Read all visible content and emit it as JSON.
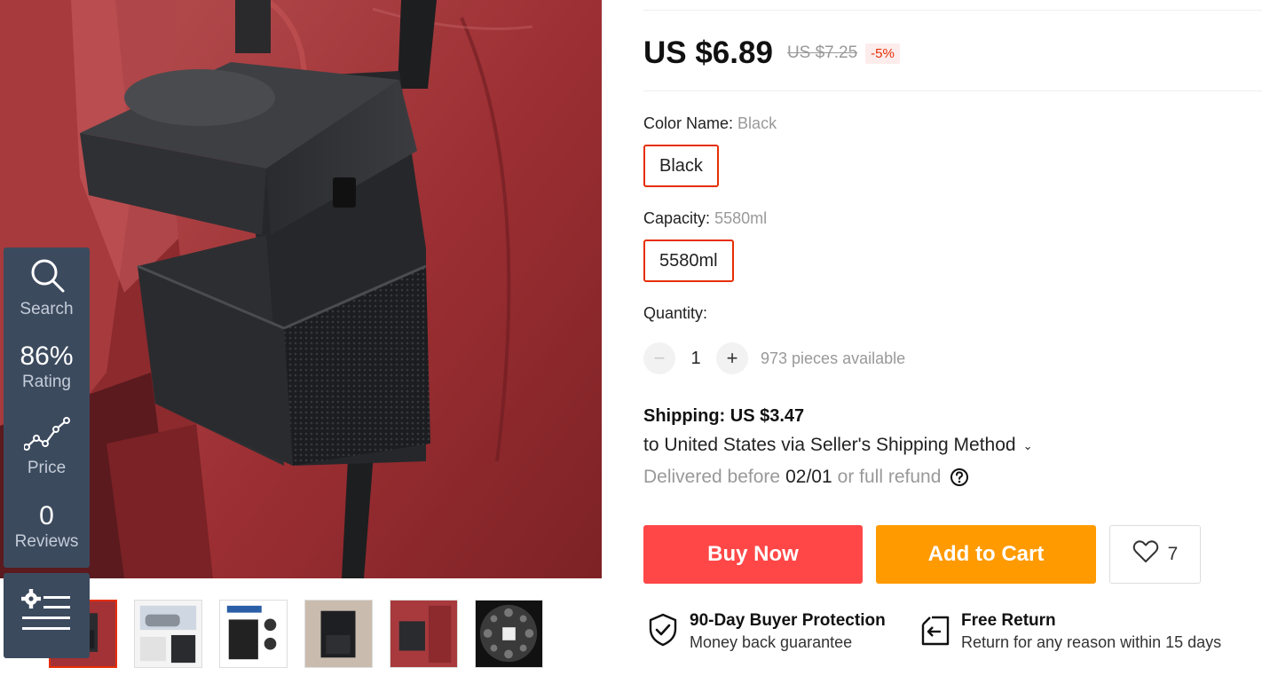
{
  "gallery": {
    "thumbnails": [
      {
        "name": "thumb-1",
        "active": true
      },
      {
        "name": "thumb-2",
        "active": false
      },
      {
        "name": "thumb-3",
        "active": false
      },
      {
        "name": "thumb-4",
        "active": false
      },
      {
        "name": "thumb-5",
        "active": false
      },
      {
        "name": "thumb-6",
        "active": false
      }
    ]
  },
  "side_widget": {
    "search_label": "Search",
    "rating_value": "86%",
    "rating_label": "Rating",
    "price_label": "Price",
    "reviews_value": "0",
    "reviews_label": "Reviews",
    "icons": [
      "search-icon",
      "trend-chart-icon",
      "settings-menu-icon"
    ]
  },
  "price": {
    "current": "US $6.89",
    "original": "US $7.25",
    "discount": "-5%"
  },
  "color": {
    "title": "Color Name:",
    "selected": "Black",
    "option": "Black"
  },
  "capacity": {
    "title": "Capacity:",
    "selected": "5580ml",
    "option": "5580ml"
  },
  "quantity": {
    "title": "Quantity:",
    "value": "1",
    "minus": "−",
    "plus": "+",
    "available": "973 pieces available"
  },
  "shipping": {
    "title": "Shipping: US $3.47",
    "method": "to United States via Seller's Shipping Method",
    "method_chevron": "⌄",
    "delivered_prefix": "Delivered before",
    "delivered_date": "02/01",
    "delivered_suffix": "or full refund"
  },
  "actions": {
    "buy_now": "Buy Now",
    "add_to_cart": "Add to Cart",
    "wishlist_count": "7"
  },
  "guarantees": {
    "protection_title": "90-Day Buyer Protection",
    "protection_sub": "Money back guarantee",
    "return_title": "Free Return",
    "return_sub": "Return for any reason within 15 days"
  },
  "colors": {
    "accent_red": "#ff4747",
    "accent_orange": "#ff9a00",
    "select_border": "#e62e04",
    "widget_bg": "#3c4a5e"
  }
}
